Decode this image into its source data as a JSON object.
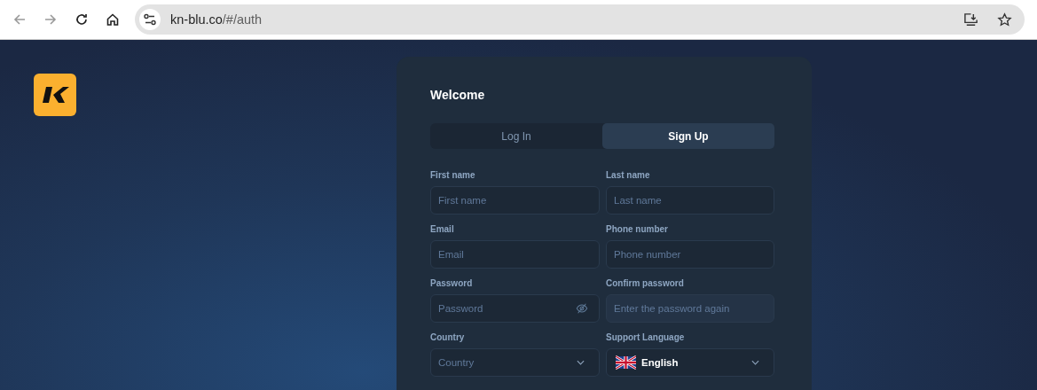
{
  "browser": {
    "url_host": "kn-blu.co",
    "url_path": "/#/auth"
  },
  "card": {
    "title": "Welcome",
    "tabs": [
      {
        "label": "Log In",
        "selected": false
      },
      {
        "label": "Sign Up",
        "selected": true
      }
    ],
    "fields": [
      {
        "kind": "text",
        "label": "First name",
        "placeholder": "First name",
        "disabled": false
      },
      {
        "kind": "text",
        "label": "Last name",
        "placeholder": "Last name",
        "disabled": false
      },
      {
        "kind": "text",
        "label": "Email",
        "placeholder": "Email",
        "disabled": false
      },
      {
        "kind": "text",
        "label": "Phone number",
        "placeholder": "Phone number",
        "disabled": false
      },
      {
        "kind": "password",
        "label": "Password",
        "placeholder": "Password",
        "disabled": false
      },
      {
        "kind": "text",
        "label": "Confirm password",
        "placeholder": "Enter the password again",
        "disabled": true
      },
      {
        "kind": "select",
        "label": "Country",
        "placeholder": "Country",
        "disabled": false
      },
      {
        "kind": "language",
        "label": "Support Language",
        "value": "English",
        "disabled": false
      }
    ]
  }
}
